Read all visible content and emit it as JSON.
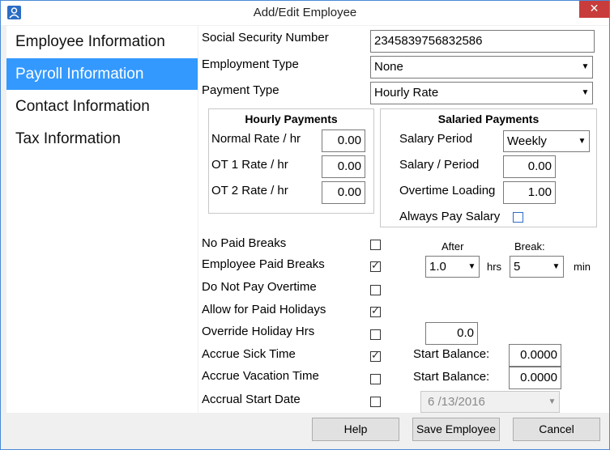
{
  "window": {
    "title": "Add/Edit Employee",
    "close_glyph": "✕",
    "app_icon": "person-icon"
  },
  "sidebar": {
    "items": [
      {
        "label": "Employee Information",
        "selected": false
      },
      {
        "label": "Payroll Information",
        "selected": true
      },
      {
        "label": "Contact Information",
        "selected": false
      },
      {
        "label": "Tax Information",
        "selected": false
      }
    ]
  },
  "form": {
    "ssn_label": "Social Security Number",
    "ssn_value": "2345839756832586",
    "employment_type_label": "Employment Type",
    "employment_type_value": "None",
    "payment_type_label": "Payment Type",
    "payment_type_value": "Hourly Rate"
  },
  "hourly": {
    "title": "Hourly Payments",
    "normal_label": "Normal Rate / hr",
    "normal_value": "0.00",
    "ot1_label": "OT 1 Rate / hr",
    "ot1_value": "0.00",
    "ot2_label": "OT 2 Rate / hr",
    "ot2_value": "0.00"
  },
  "salaried": {
    "title": "Salaried Payments",
    "period_label": "Salary Period",
    "period_value": "Weekly",
    "salary_label": "Salary / Period",
    "salary_value": "0.00",
    "loading_label": "Overtime Loading",
    "loading_value": "1.00",
    "always_pay_label": "Always Pay Salary",
    "always_pay_checked": false
  },
  "options": {
    "no_paid_breaks": {
      "label": "No Paid Breaks",
      "checked": false
    },
    "employee_paid_breaks": {
      "label": "Employee Paid Breaks",
      "checked": true
    },
    "do_not_pay_overtime": {
      "label": "Do Not Pay Overtime",
      "checked": false
    },
    "allow_paid_holidays": {
      "label": "Allow for Paid Holidays",
      "checked": true
    },
    "override_holiday_hrs": {
      "label": "Override Holiday Hrs",
      "checked": false,
      "value": "0.0"
    },
    "accrue_sick_time": {
      "label": "Accrue Sick Time",
      "checked": true,
      "start_balance_label": "Start Balance:",
      "start_balance": "0.0000"
    },
    "accrue_vacation_time": {
      "label": "Accrue Vacation Time",
      "checked": false,
      "start_balance_label": "Start Balance:",
      "start_balance": "0.0000"
    },
    "accrual_start_date": {
      "label": "Accrual Start Date",
      "checked": false,
      "value": "6 /13/2016"
    }
  },
  "breaks": {
    "after_label": "After",
    "after_value": "1.0",
    "hrs_label": "hrs",
    "break_label": "Break:",
    "break_value": "5",
    "min_label": "min"
  },
  "footer": {
    "help_label": "Help",
    "save_label": "Save Employee",
    "cancel_label": "Cancel"
  },
  "glyphs": {
    "checkmark": "✓",
    "dropdown_arrow": "▼"
  }
}
